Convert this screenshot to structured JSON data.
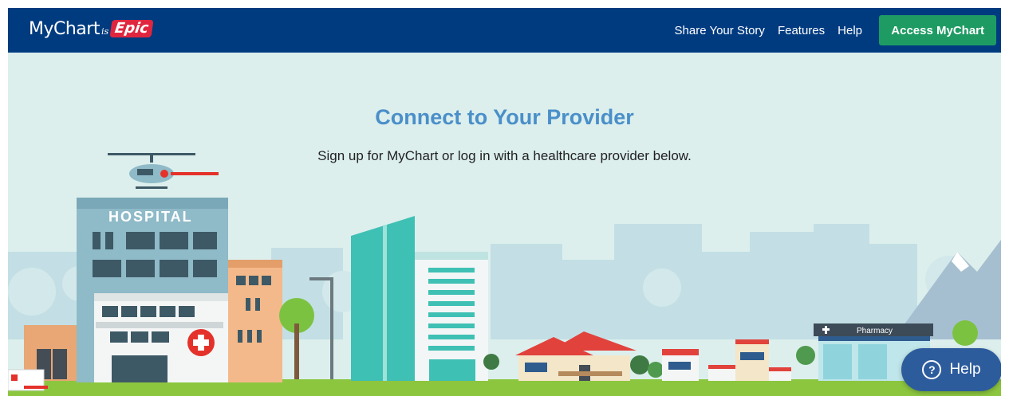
{
  "header": {
    "logo": {
      "main": "MyChart",
      "is": "is",
      "brand": "Epic"
    },
    "nav": [
      {
        "label": "Share Your Story"
      },
      {
        "label": "Features"
      },
      {
        "label": "Help"
      }
    ],
    "access_button": "Access MyChart"
  },
  "hero": {
    "title": "Connect to Your Provider",
    "subtitle": "Sign up for MyChart or log in with a healthcare provider below.",
    "illustration": {
      "hospital_sign": "HOSPITAL",
      "pharmacy_sign": "Pharmacy"
    }
  },
  "help_fab": {
    "label": "Help",
    "icon": "question-circle-icon"
  },
  "colors": {
    "nav_bg": "#003b80",
    "access_button": "#1e9b63",
    "title": "#4a8fc9",
    "hero_bg": "#dcefed",
    "help_fab": "#2d5c9d"
  }
}
